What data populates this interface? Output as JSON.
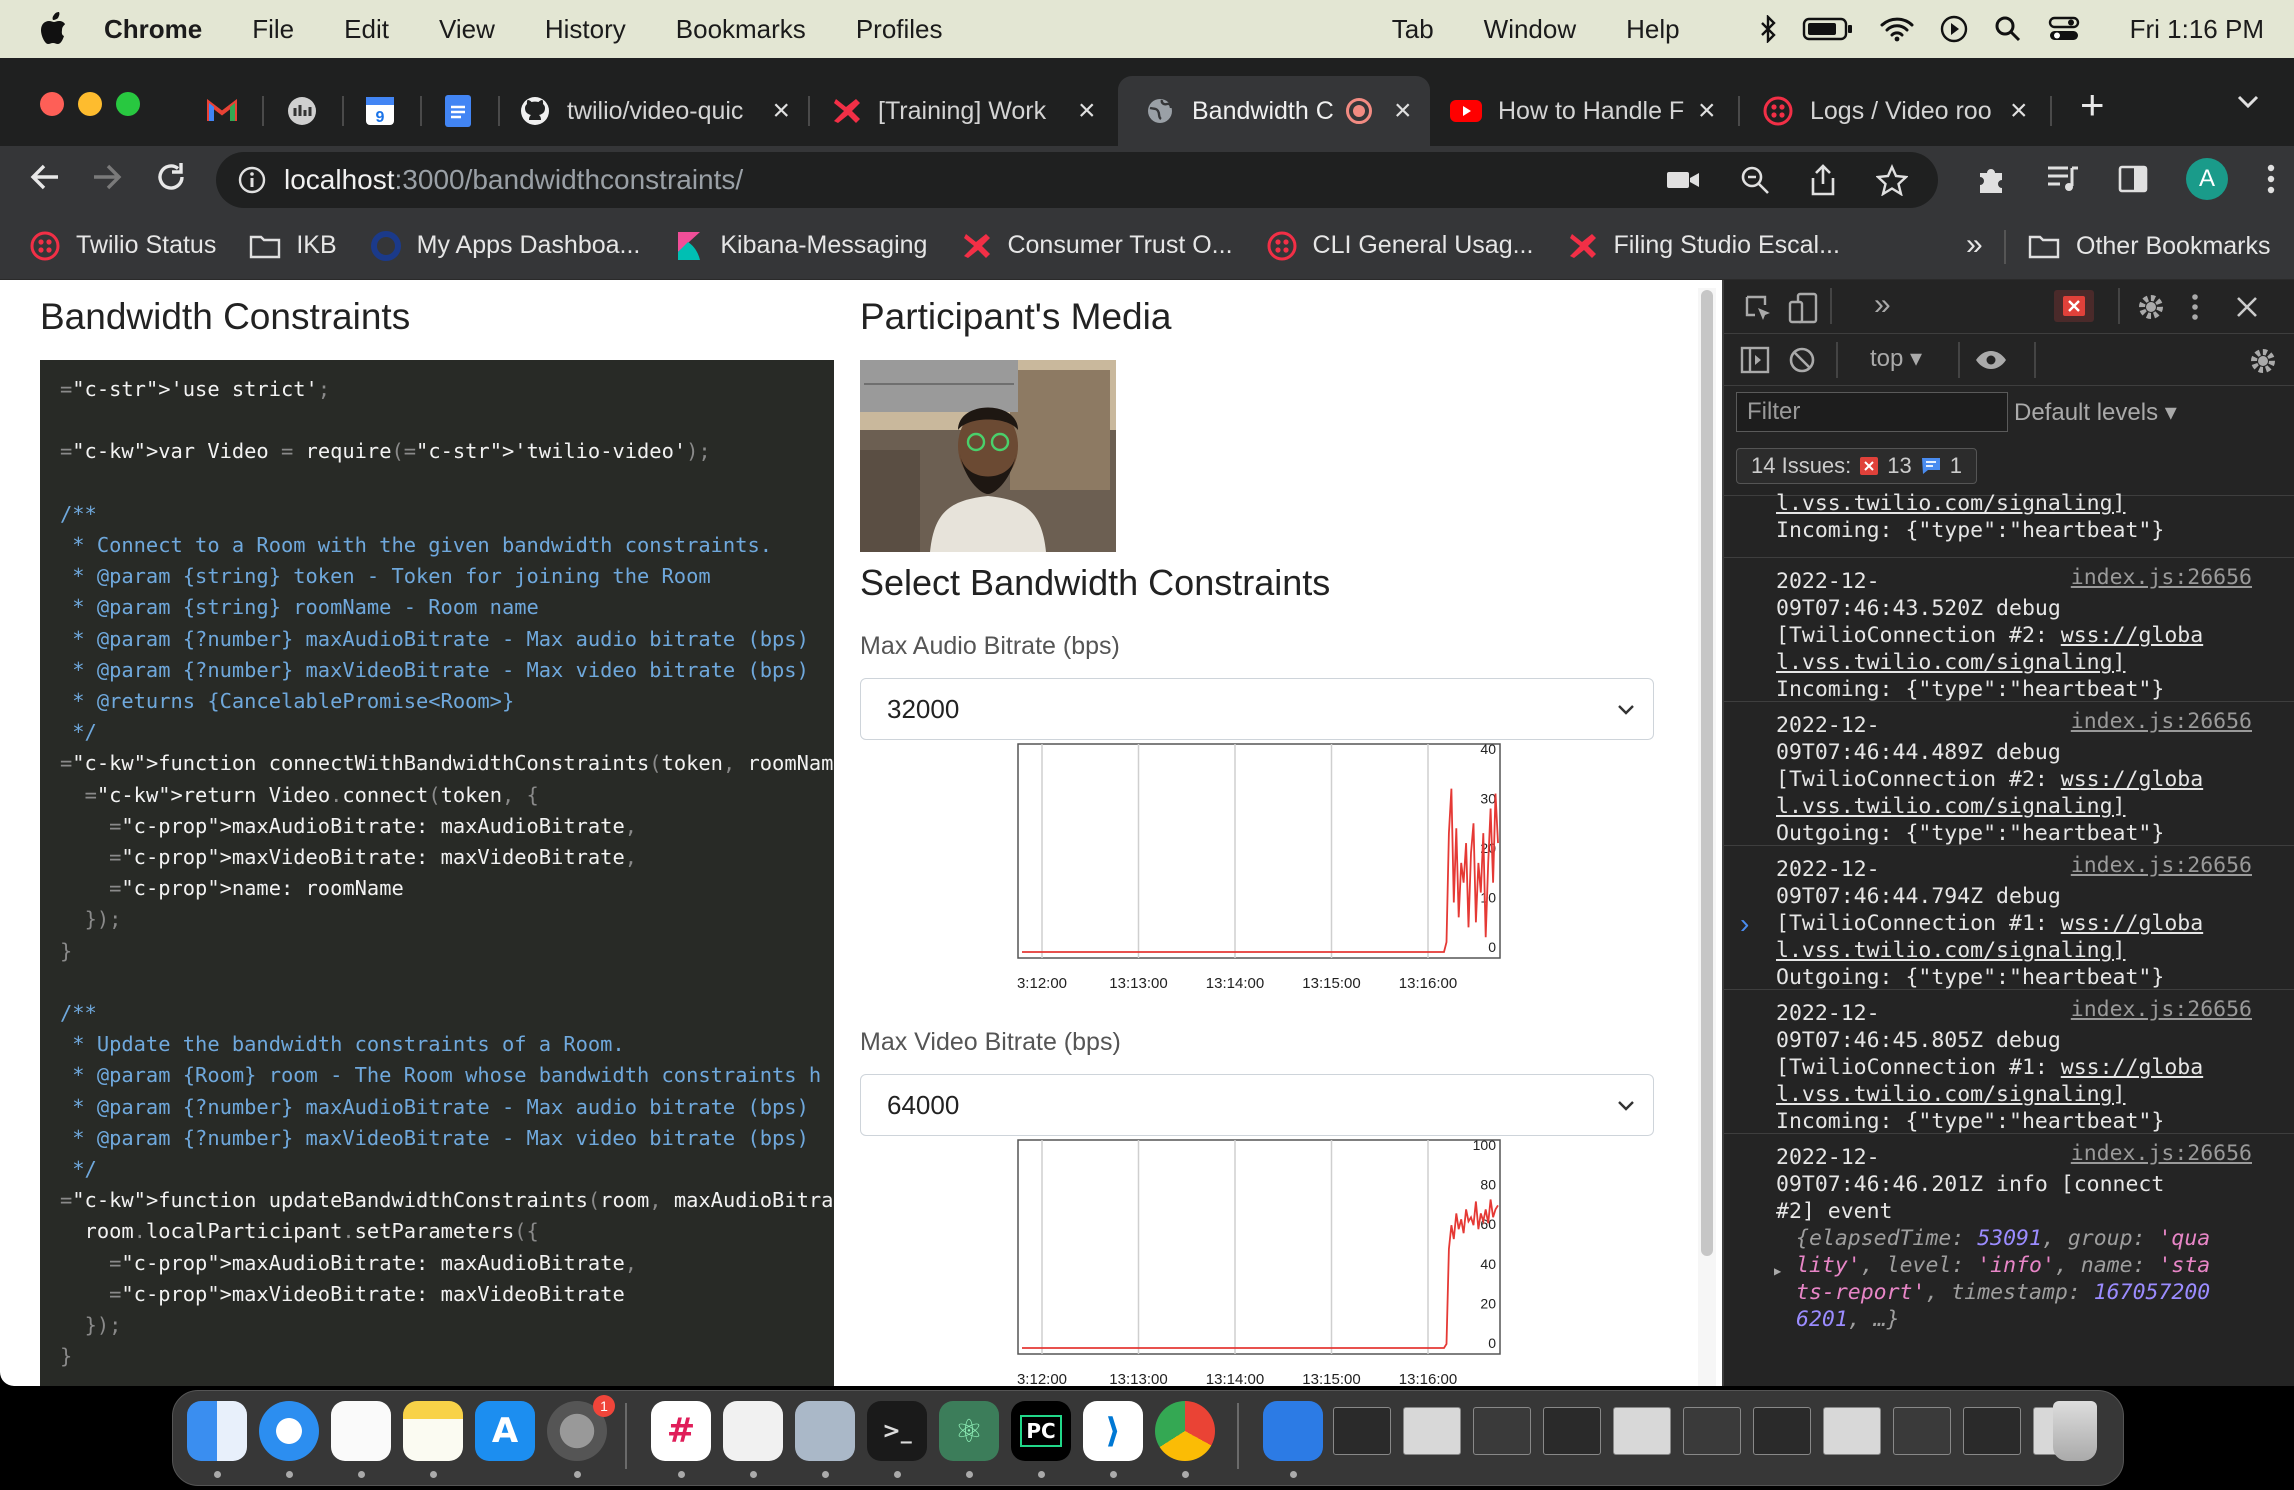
{
  "menubar": {
    "app": "Chrome",
    "items": [
      "File",
      "Edit",
      "View",
      "History",
      "Bookmarks",
      "Profiles"
    ],
    "right_items": [
      "Tab",
      "Window",
      "Help"
    ],
    "clock": "Fri  1:16 PM"
  },
  "tabs": [
    {
      "title": "",
      "icon": "gmail-icon"
    },
    {
      "title": "",
      "icon": "app-icon"
    },
    {
      "title": "",
      "icon": "calendar-icon"
    },
    {
      "title": "",
      "icon": "docs-icon"
    },
    {
      "title": "twilio/video-quic",
      "icon": "github-icon"
    },
    {
      "title": "[Training] Work",
      "icon": "twilio-red-icon"
    },
    {
      "title": "Bandwidth C",
      "icon": "globe-icon"
    },
    {
      "title": "How to Handle F",
      "icon": "youtube-icon"
    },
    {
      "title": "Logs / Video roo",
      "icon": "twilio-icon"
    }
  ],
  "address": {
    "host": "localhost",
    "path": ":3000/bandwidthconstraints/"
  },
  "profile_initial": "A",
  "bookmarks": [
    {
      "label": "Twilio Status",
      "icon": "twilio-icon"
    },
    {
      "label": "IKB",
      "icon": "folder-icon"
    },
    {
      "label": "My Apps Dashboa...",
      "icon": "okta-icon"
    },
    {
      "label": "Kibana-Messaging",
      "icon": "kibana-icon"
    },
    {
      "label": "Consumer Trust O...",
      "icon": "twilio-red-icon"
    },
    {
      "label": "CLI General Usag...",
      "icon": "twilio-icon"
    },
    {
      "label": "Filing Studio Escal...",
      "icon": "twilio-red-icon"
    }
  ],
  "bookmarks_more": "»",
  "other_bookmarks": "Other Bookmarks",
  "page": {
    "left_title": "Bandwidth Constraints",
    "right_title": "Participant's Media",
    "select_title": "Select Bandwidth Constraints",
    "audio_label": "Max Audio Bitrate (bps)",
    "audio_value": "32000",
    "video_label": "Max Video Bitrate (bps)",
    "video_value": "64000",
    "code_lines": [
      "'use strict';",
      "",
      "var Video = require('twilio-video');",
      "",
      "/**",
      " * Connect to a Room with the given bandwidth constraints.",
      " * @param {string} token - Token for joining the Room",
      " * @param {string} roomName - Room name",
      " * @param {?number} maxAudioBitrate - Max audio bitrate (bps)",
      " * @param {?number} maxVideoBitrate - Max video bitrate (bps)",
      " * @returns {CancelablePromise<Room>}",
      " */",
      "function connectWithBandwidthConstraints(token, roomName, maxA",
      "  return Video.connect(token, {",
      "    maxAudioBitrate: maxAudioBitrate,",
      "    maxVideoBitrate: maxVideoBitrate,",
      "    name: roomName",
      "  });",
      "}",
      "",
      "/**",
      " * Update the bandwidth constraints of a Room.",
      " * @param {Room} room - The Room whose bandwidth constraints h",
      " * @param {?number} maxAudioBitrate - Max audio bitrate (bps)",
      " * @param {?number} maxVideoBitrate - Max video bitrate (bps)",
      " */",
      "function updateBandwidthConstraints(room, maxAudioBitrate, max",
      "  room.localParticipant.setParameters({",
      "    maxAudioBitrate: maxAudioBitrate,",
      "    maxVideoBitrate: maxVideoBitrate",
      "  });",
      "}"
    ]
  },
  "chart_data": [
    {
      "type": "line",
      "x_ticks": [
        "3:12:00",
        "13:13:00",
        "13:14:00",
        "13:15:00",
        "13:16:00"
      ],
      "y_ticks": [
        "40",
        "30",
        "20",
        "10",
        "0"
      ],
      "ylim": [
        0,
        40
      ],
      "color": "#e53935",
      "series": [
        {
          "values": [
            0,
            0,
            0,
            0,
            0,
            0,
            0,
            0,
            0,
            0,
            0,
            0,
            0,
            0,
            0,
            0,
            0,
            0,
            0,
            0,
            0,
            0,
            0,
            0,
            0,
            0,
            0,
            0,
            0,
            0,
            0,
            0,
            0,
            0,
            0,
            0,
            0,
            0,
            0,
            0,
            0,
            2,
            24,
            33,
            10,
            25,
            7,
            18,
            14,
            22,
            5,
            20,
            26,
            6,
            18,
            12,
            24,
            3,
            18,
            29,
            14,
            32,
            22
          ]
        }
      ]
    },
    {
      "type": "line",
      "x_ticks": [
        "3:12:00",
        "13:13:00",
        "13:14:00",
        "13:15:00",
        "13:16:00"
      ],
      "y_ticks": [
        "100",
        "80",
        "60",
        "40",
        "20",
        "0"
      ],
      "ylim": [
        0,
        100
      ],
      "color": "#e53935",
      "series": [
        {
          "values": [
            0,
            0,
            0,
            0,
            0,
            0,
            0,
            0,
            0,
            0,
            0,
            0,
            0,
            0,
            0,
            0,
            0,
            0,
            0,
            0,
            0,
            0,
            0,
            0,
            0,
            0,
            0,
            0,
            0,
            0,
            0,
            0,
            0,
            0,
            0,
            0,
            0,
            0,
            0,
            0,
            0,
            2,
            50,
            62,
            55,
            68,
            60,
            65,
            58,
            70,
            64,
            66,
            62,
            74,
            60,
            68,
            64,
            70,
            63,
            75,
            66,
            70,
            72
          ]
        }
      ]
    }
  ],
  "devtools": {
    "context": "top",
    "filter_placeholder": "Filter",
    "levels": "Default levels",
    "issues_label": "14 Issues:",
    "issues_errors": "13",
    "issues_info": "1",
    "top_partial": [
      "l.vss.twilio.com/signaling]",
      "Incoming: {\"type\":\"heartbeat\"}"
    ],
    "logs": [
      {
        "src": "index.js:26656",
        "lines": [
          "2022-12-",
          "09T07:46:43.520Z debug",
          "[TwilioConnection #2: ",
          "l.vss.twilio.com/signaling]",
          "Incoming: {\"type\":\"heartbeat\"}"
        ],
        "link1": "wss://globa"
      },
      {
        "src": "index.js:26656",
        "lines": [
          "2022-12-",
          "09T07:46:44.489Z debug",
          "[TwilioConnection #2: ",
          "l.vss.twilio.com/signaling]",
          "Outgoing: {\"type\":\"heartbeat\"}"
        ],
        "link1": "wss://globa"
      },
      {
        "src": "index.js:26656",
        "lines": [
          "2022-12-",
          "09T07:46:44.794Z debug",
          "[TwilioConnection #1: ",
          "l.vss.twilio.com/signaling]",
          "Outgoing: {\"type\":\"heartbeat\"}"
        ],
        "link1": "wss://globa"
      },
      {
        "src": "index.js:26656",
        "lines": [
          "2022-12-",
          "09T07:46:45.805Z debug",
          "[TwilioConnection #1: ",
          "l.vss.twilio.com/signaling]",
          "Incoming: {\"type\":\"heartbeat\"}"
        ],
        "link1": "wss://globa"
      }
    ],
    "last_log": {
      "src": "index.js:26656",
      "line1": "2022-12-",
      "line2": "09T07:46:46.201Z info [connect",
      "line3": "#2] event",
      "obj": [
        [
          [
            "k",
            "{elapsedTime: "
          ],
          [
            "n",
            "53091"
          ],
          [
            "k",
            ", group: "
          ],
          [
            "s",
            "'qua"
          ]
        ],
        [
          [
            "s",
            "lity'"
          ],
          [
            "k",
            ", level: "
          ],
          [
            "s",
            "'info'"
          ],
          [
            "k",
            ", name: "
          ],
          [
            "s",
            "'sta"
          ]
        ],
        [
          [
            "s",
            "ts-report'"
          ],
          [
            "k",
            ", timestamp: "
          ],
          [
            "n",
            "167057200"
          ]
        ],
        [
          [
            "n",
            "6201"
          ],
          [
            "k",
            ", …}"
          ]
        ]
      ]
    },
    "prompt": "›"
  },
  "dock": {
    "apps": [
      "finder-icon",
      "safari-icon",
      "reminders-icon",
      "notes-icon",
      "app-store-icon",
      "system-preferences-icon",
      "slack-icon",
      "textedit-icon",
      "preview-icon",
      "terminal-icon",
      "atom-icon",
      "pycharm-icon",
      "vscode-icon",
      "chrome-icon",
      "xcode-icon"
    ],
    "system_prefs_badge": "1",
    "pycharm_label": "PC"
  }
}
